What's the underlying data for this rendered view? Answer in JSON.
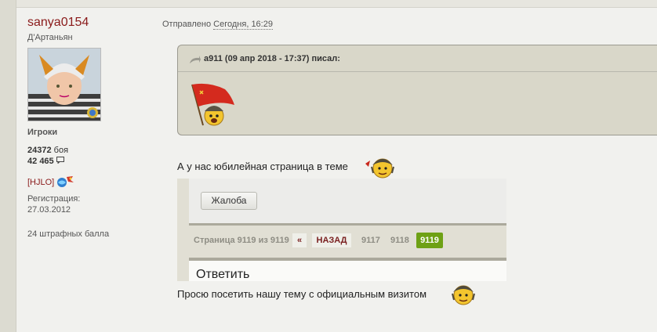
{
  "user": {
    "name": "sanya0154",
    "rank": "Д'Артаньян",
    "group": "Игроки",
    "battles_count": "24372",
    "battles_label": "боя",
    "posts_a": "42",
    "posts_b": "465",
    "clan": "[HJLO]",
    "reg_label": "Регистрация:",
    "reg_date": "27.03.2012",
    "penalty": "24 штрафных балла"
  },
  "post": {
    "sent_label": "Отправлено",
    "sent_when": "Сегодня, 16:29",
    "quote_author": "a911 (09 апр 2018 - 17:37) писал:",
    "line1": "А у нас юбилейная страница в теме",
    "line2": "Просю посетить нашу тему с официальным визитом"
  },
  "embedded": {
    "complaint_button": "Жалоба",
    "page_text": "Страница 9119 из 9119",
    "first": "«",
    "back": "НАЗАД",
    "page_a": "9117",
    "page_b": "9118",
    "page_current": "9119",
    "reply_title": "Ответить"
  },
  "icons": {
    "quote_icon": "quote-arrow-icon",
    "post_icon": "speech-bubble-icon",
    "clan_icon": "clan-emblem-icon",
    "smiley": "soldier-smiley-icon"
  },
  "colors": {
    "username": "#8a1a1a",
    "quote_bg": "#d9d7c9",
    "current_page": "#6ea115"
  }
}
